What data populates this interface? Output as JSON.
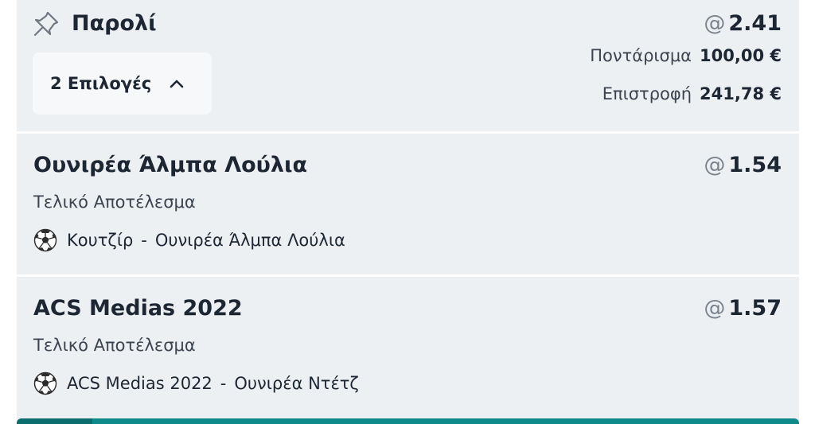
{
  "parlay": {
    "title": "Παρολί",
    "at_symbol": "@",
    "odds": "2.41",
    "selections_label": "2 Επιλογές",
    "stake_label": "Ποντάρισμα",
    "stake_value": "100,00 €",
    "return_label": "Επιστροφή",
    "return_value": "241,78 €",
    "icons": {
      "pin": "pin-icon",
      "toggle": "chevron-up-icon"
    }
  },
  "selections": [
    {
      "name": "Ουνιρέα Άλμπα Λούλια",
      "at_symbol": "@",
      "odds": "1.54",
      "market": "Τελικό Αποτέλεσμα",
      "home": "Κουτζίρ",
      "separator": "-",
      "away": "Ουνιρέα Άλμπα Λούλια",
      "sport_icon": "soccer-ball-icon"
    },
    {
      "name": "ACS Medias 2022",
      "at_symbol": "@",
      "odds": "1.57",
      "market": "Τελικό Αποτέλεσμα",
      "home": "ACS Medias 2022",
      "separator": "-",
      "away": "Ουνιρέα Ντέτζ",
      "sport_icon": "soccer-ball-icon"
    }
  ],
  "colors": {
    "card_bg": "#edf0f3",
    "text_primary": "#1d2633",
    "text_muted": "#7a828c",
    "accent_bar": "#0e8a8a"
  }
}
